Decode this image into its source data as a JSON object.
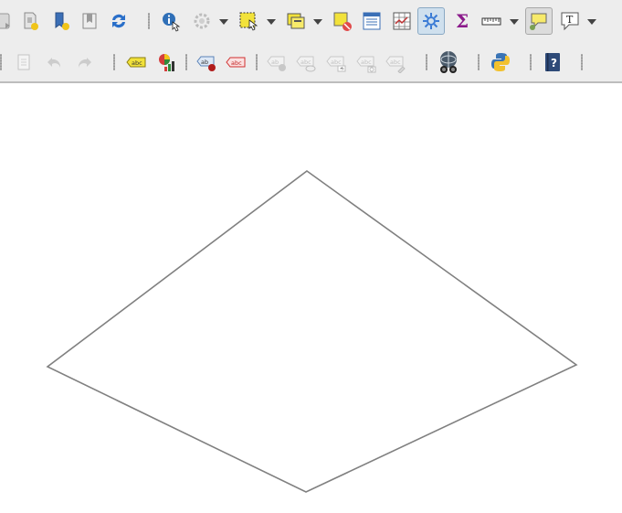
{
  "toolbar_row1": [
    {
      "name": "add-layer-icon-partial"
    },
    {
      "name": "new-shapefile-layer-icon"
    },
    {
      "name": "new-geopackage-layer-icon"
    },
    {
      "name": "new-temporary-layer-icon"
    },
    {
      "name": "refresh-icon"
    },
    {
      "name": "identify-features-icon"
    },
    {
      "name": "run-feature-action-icon"
    },
    {
      "name": "select-features-icon"
    },
    {
      "name": "select-by-value-icon"
    },
    {
      "name": "deselect-features-icon"
    },
    {
      "name": "open-attribute-table-icon"
    },
    {
      "name": "field-calculator-icon"
    },
    {
      "name": "processing-toolbox-icon"
    },
    {
      "name": "statistical-summary-icon"
    },
    {
      "name": "measure-line-icon"
    },
    {
      "name": "map-tips-icon"
    },
    {
      "name": "text-annotation-icon"
    }
  ],
  "toolbar_row2": [
    {
      "name": "current-edits-icon"
    },
    {
      "name": "undo-icon"
    },
    {
      "name": "redo-icon"
    },
    {
      "name": "layer-labeling-options-icon"
    },
    {
      "name": "layer-diagram-options-icon"
    },
    {
      "name": "highlight-pinned-labels-icon"
    },
    {
      "name": "pin-unpin-labels-icon"
    },
    {
      "name": "show-hide-labels-icon"
    },
    {
      "name": "move-label-icon"
    },
    {
      "name": "rotate-label-icon"
    },
    {
      "name": "change-label-icon"
    },
    {
      "name": "metasearch-icon"
    },
    {
      "name": "python-console-icon"
    },
    {
      "name": "help-icon"
    }
  ],
  "canvas": {
    "feature_stroke": "#808080",
    "feature_fill": "#ffffff"
  },
  "colors": {
    "toolbar_bg": "#ededed",
    "canvas_bg": "#ffffff",
    "label_yellow": "#f2e23a",
    "label_red": "#e04a4a",
    "refresh_blue": "#2a6fc9",
    "sigma_purple": "#8b1a8b"
  }
}
